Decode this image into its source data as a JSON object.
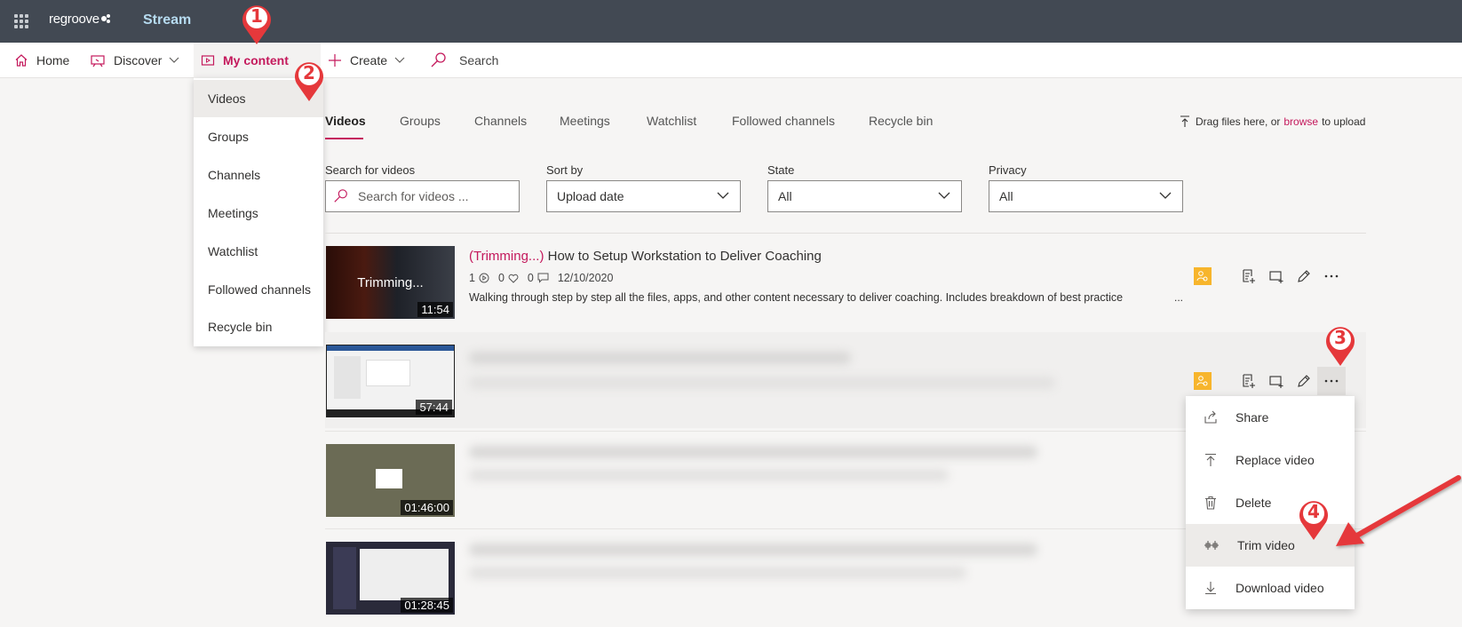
{
  "app": {
    "org_name": "regroove",
    "app_name": "Stream",
    "waffle_icon": "waffle-icon"
  },
  "nav": {
    "home": "Home",
    "discover": "Discover",
    "my_content": "My content",
    "create": "Create",
    "search": "Search"
  },
  "my_content_menu": [
    "Videos",
    "Groups",
    "Channels",
    "Meetings",
    "Watchlist",
    "Followed channels",
    "Recycle bin"
  ],
  "tabs": [
    "Videos",
    "Groups",
    "Channels",
    "Meetings",
    "Watchlist",
    "Followed channels",
    "Recycle bin"
  ],
  "upload": {
    "prefix": "Drag files here, or",
    "link": "browse",
    "suffix": "to upload"
  },
  "filters": {
    "search": {
      "label": "Search for videos",
      "placeholder": "Search for videos ..."
    },
    "sort": {
      "label": "Sort by",
      "value": "Upload date"
    },
    "state": {
      "label": "State",
      "value": "All"
    },
    "privacy": {
      "label": "Privacy",
      "value": "All"
    }
  },
  "videos": [
    {
      "state": "(Trimming...)",
      "title": "How to Setup Workstation to Deliver Coaching",
      "thumb_overlay": "Trimming...",
      "duration": "11:54",
      "views": "1",
      "likes": "0",
      "comments": "0",
      "date": "12/10/2020",
      "description": "Walking through step by step all the files, apps, and other content necessary to deliver coaching. Includes breakdown of best practice",
      "more": "..."
    },
    {
      "duration": "57:44"
    },
    {
      "duration": "01:46:00"
    },
    {
      "duration": "01:28:45"
    }
  ],
  "context_menu": [
    "Share",
    "Replace video",
    "Delete",
    "Trim video",
    "Download video"
  ],
  "markers": [
    "1",
    "2",
    "3",
    "4"
  ],
  "colors": {
    "accent": "#c4195c",
    "topbar": "#424953",
    "marker": "#e5383b",
    "badge": "#f7b52c"
  }
}
